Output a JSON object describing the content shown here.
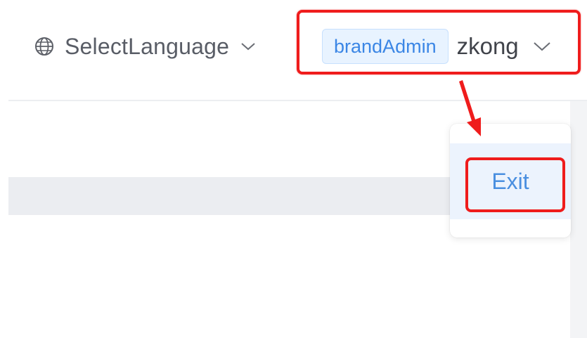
{
  "header": {
    "language_selector": {
      "label": "SelectLanguage",
      "icon": "globe-icon",
      "dropdown_icon": "chevron-down-icon"
    },
    "user": {
      "role_badge": "brandAdmin",
      "username": "zkong",
      "dropdown_icon": "chevron-down-icon"
    }
  },
  "user_menu": {
    "items": [
      {
        "label": "Exit"
      }
    ]
  },
  "colors": {
    "accent": "#3b86e5",
    "badge_bg": "#e8f3ff",
    "menu_hover": "#ecf3fd",
    "annotation": "#ef1c1c"
  }
}
